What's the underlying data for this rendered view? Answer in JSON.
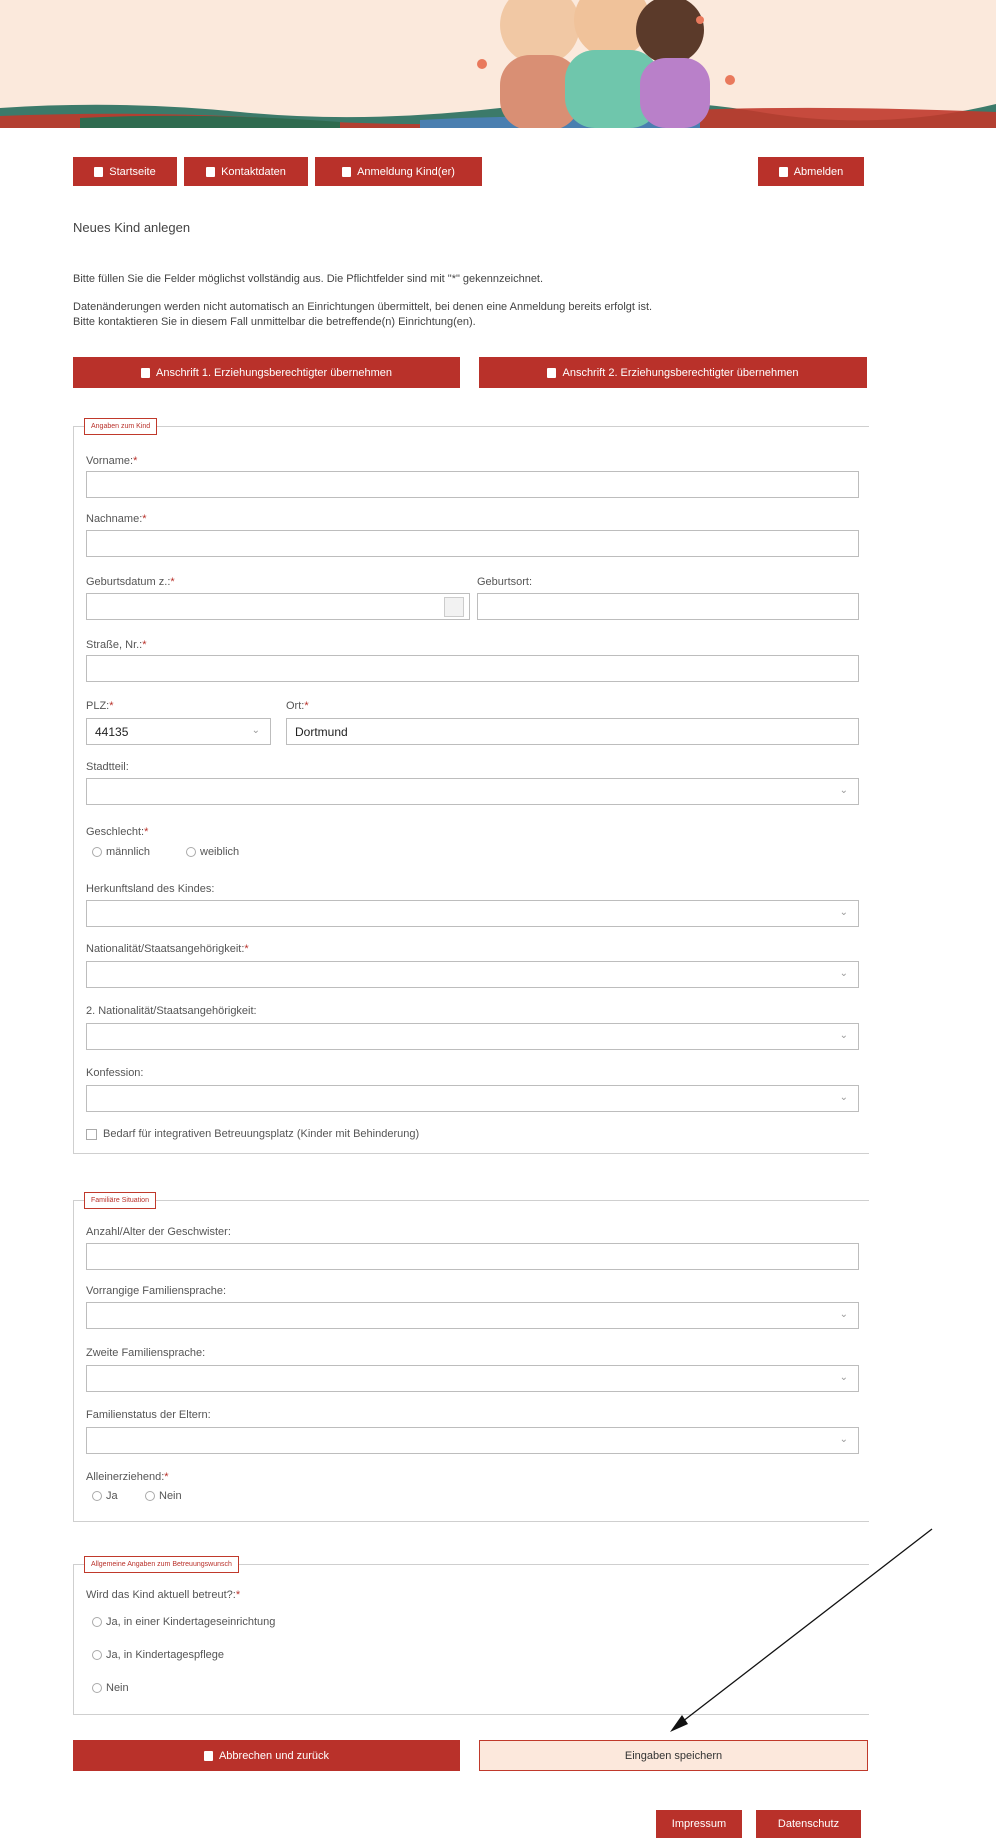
{
  "colors": {
    "accent": "#b9312a",
    "banner_bg": "#fbe9dc",
    "save_bg": "#fce8dc"
  },
  "top_nav": {
    "start_label": "Startseite",
    "contact_label": "Kontaktdaten",
    "registration_label": "Anmeldung Kind(er)",
    "logout_label": "Abmelden"
  },
  "page_title": "Neues Kind anlegen",
  "intro": {
    "line1": "Bitte füllen Sie die Felder möglichst vollständig aus. Die Pflichtfelder sind mit \"*\" gekennzeichnet.",
    "line2": "Datenänderungen werden nicht automatisch an Einrichtungen übermittelt, bei denen eine Anmeldung bereits erfolgt ist.",
    "line3": "Bitte kontaktieren Sie in diesem Fall unmittelbar die betreffende(n) Einrichtung(en)."
  },
  "copy_buttons": {
    "guardian1": "Anschrift 1. Erziehungsberechtigter übernehmen",
    "guardian2": "Anschrift 2. Erziehungsberechtigter übernehmen"
  },
  "child_section": {
    "legend": "Angaben zum Kind",
    "first_name_label": "Vorname:",
    "last_name_label": "Nachname:",
    "birthdate_label": "Geburtsdatum z.:",
    "birthplace_label": "Geburtsort:",
    "street_label": "Straße, Nr.:",
    "zip_label": "PLZ:",
    "zip_value": "44135",
    "city_label": "Ort:",
    "city_value": "Dortmund",
    "district_label": "Stadtteil:",
    "gender_label": "Geschlecht:",
    "gender_male": "männlich",
    "gender_female": "weiblich",
    "origin_label": "Herkunftsland des Kindes:",
    "nationality_label": "Nationalität/Staatsangehörigkeit:",
    "nationality2_label": "2. Nationalität/Staatsangehörigkeit:",
    "confession_label": "Konfession:",
    "integration_label": "Bedarf für integrativen Betreuungsplatz (Kinder mit Behinderung)"
  },
  "family_section": {
    "legend": "Familiäre Situation",
    "siblings_label": "Anzahl/Alter der Geschwister:",
    "primary_language_label": "Vorrangige Familiensprache:",
    "second_language_label": "Zweite Familiensprache:",
    "family_status_label": "Familienstatus der Eltern:",
    "single_parent_label": "Alleinerziehend:",
    "yes": "Ja",
    "no": "Nein"
  },
  "care_section": {
    "legend": "Allgemeine Angaben zum Betreuungswunsch",
    "question": "Wird das Kind aktuell betreut?:",
    "option1": "Ja, in einer Kindertageseinrichtung",
    "option2": "Ja, in Kindertagespflege",
    "option3": "Nein"
  },
  "footer_actions": {
    "cancel_label": "Abbrechen und zurück",
    "save_label": "Eingaben speichern"
  },
  "footer_links": {
    "imprint": "Impressum",
    "privacy": "Datenschutz"
  }
}
